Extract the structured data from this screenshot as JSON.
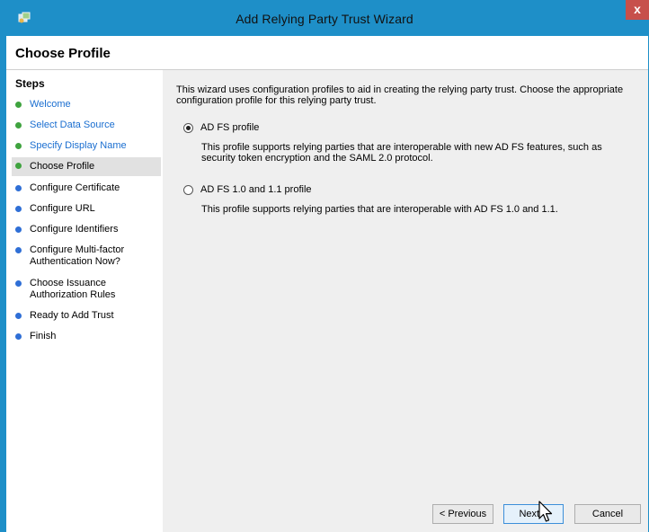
{
  "window": {
    "title": "Add Relying Party Trust Wizard",
    "close_glyph": "x"
  },
  "header": {
    "title": "Choose Profile"
  },
  "steps": {
    "heading": "Steps",
    "items": [
      {
        "label": "Welcome",
        "status": "done",
        "link": true
      },
      {
        "label": "Select Data Source",
        "status": "done",
        "link": true
      },
      {
        "label": "Specify Display Name",
        "status": "done",
        "link": true
      },
      {
        "label": "Choose Profile",
        "status": "current",
        "link": false
      },
      {
        "label": "Configure Certificate",
        "status": "todo",
        "link": false
      },
      {
        "label": "Configure URL",
        "status": "todo",
        "link": false
      },
      {
        "label": "Configure Identifiers",
        "status": "todo",
        "link": false
      },
      {
        "label": "Configure Multi-factor Authentication Now?",
        "status": "todo",
        "link": false
      },
      {
        "label": "Choose Issuance Authorization Rules",
        "status": "todo",
        "link": false
      },
      {
        "label": "Ready to Add Trust",
        "status": "todo",
        "link": false
      },
      {
        "label": "Finish",
        "status": "todo",
        "link": false
      }
    ]
  },
  "main": {
    "intro": "This wizard uses configuration profiles to aid in creating the relying party trust.  Choose the appropriate configuration profile for this relying party trust.",
    "options": [
      {
        "label": "AD FS profile",
        "selected": true,
        "description": "This profile supports relying parties that are interoperable with new AD FS features, such as security token encryption and the SAML 2.0 protocol."
      },
      {
        "label": "AD FS 1.0 and 1.1 profile",
        "selected": false,
        "description": "This profile supports relying parties that are interoperable with AD FS 1.0 and 1.1."
      }
    ]
  },
  "buttons": {
    "previous": "< Previous",
    "next": "Next >",
    "cancel": "Cancel"
  },
  "colors": {
    "titlebar": "#1e8fc8",
    "step_done": "#3fa33f",
    "step_todo": "#2f6fd6",
    "link_text": "#1a6ed0",
    "close_button": "#c7504b"
  },
  "icons": [
    "app-icon",
    "close-icon",
    "mouse-pointer-icon"
  ]
}
